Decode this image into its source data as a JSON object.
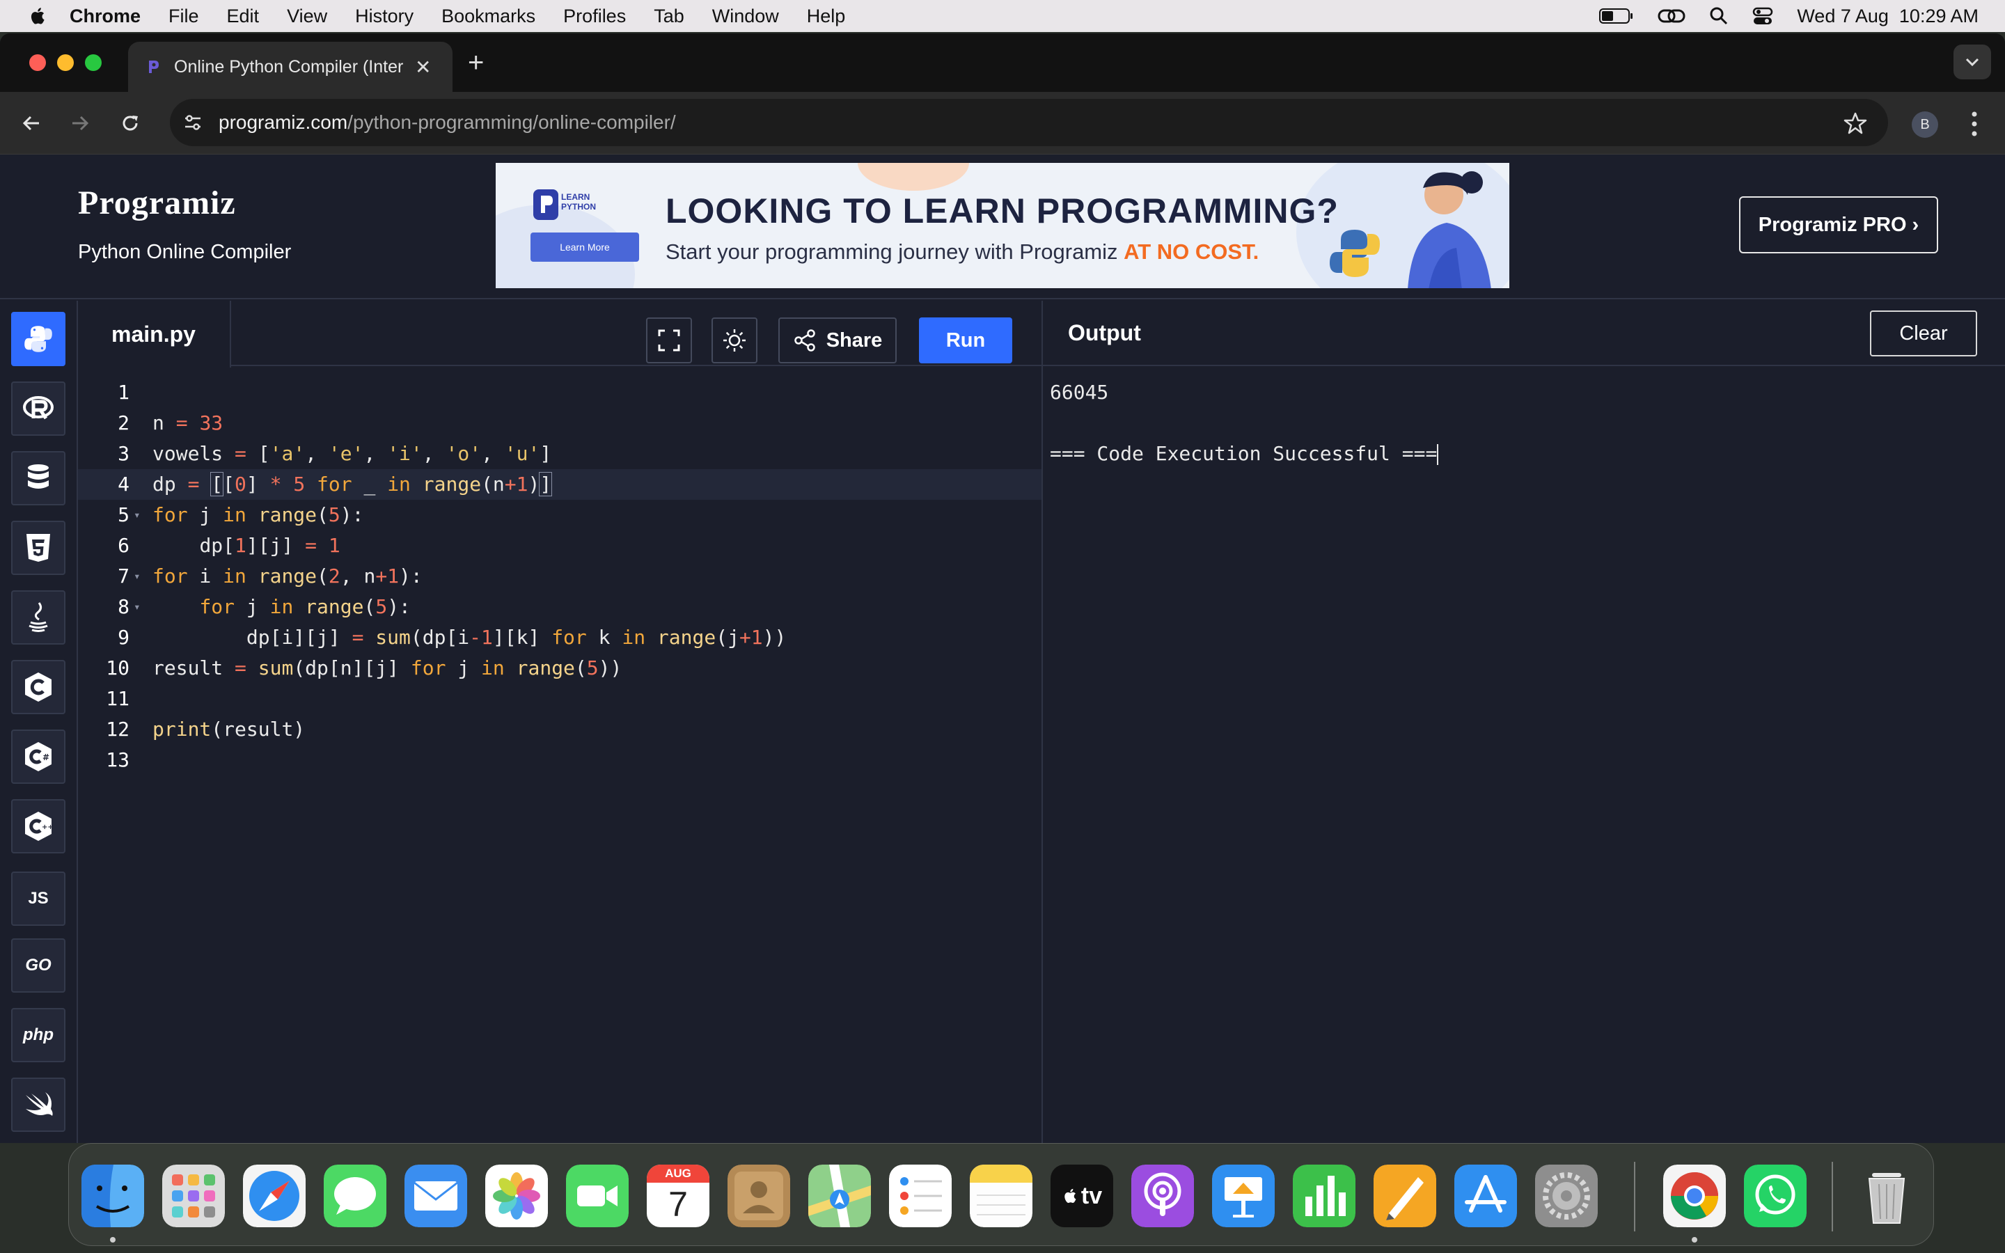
{
  "menubar": {
    "items": [
      "Chrome",
      "File",
      "Edit",
      "View",
      "History",
      "Bookmarks",
      "Profiles",
      "Tab",
      "Window",
      "Help"
    ],
    "datetime": "Wed 7 Aug  10:29 AM"
  },
  "browser": {
    "tab_title": "Online Python Compiler (Inter",
    "url_host": "programiz.com",
    "url_path": "/python-programming/online-compiler/",
    "profile_initial": "B"
  },
  "site": {
    "logo": "Programiz",
    "subtitle": "Python Online Compiler",
    "banner_title": "LOOKING TO LEARN PROGRAMMING?",
    "banner_sub": "Start your programming journey with Programiz ",
    "banner_em": "AT NO COST.",
    "banner_badge": "LEARN PYTHON",
    "banner_button": "Learn More",
    "pro_button": "Programiz PRO ›"
  },
  "sidebar": {
    "languages": [
      "python",
      "r",
      "sql",
      "html",
      "java",
      "c",
      "csharp",
      "cpp",
      "js",
      "go",
      "php",
      "swift"
    ],
    "labels": {
      "js": "JS",
      "go": "GO",
      "php": "php"
    }
  },
  "editor": {
    "filename": "main.py",
    "share_label": "Share",
    "run_label": "Run",
    "line_numbers": [
      "1",
      "2",
      "3",
      "4",
      "5",
      "6",
      "7",
      "8",
      "9",
      "10",
      "11",
      "12",
      "13"
    ]
  },
  "output": {
    "title": "Output",
    "clear_label": "Clear",
    "lines": [
      "66045",
      "",
      "=== Code Execution Successful ==="
    ]
  },
  "dock": {
    "apps": [
      "Finder",
      "Launchpad",
      "Safari",
      "Messages",
      "Mail",
      "Photos",
      "FaceTime",
      "Calendar",
      "Contacts",
      "Maps",
      "Reminders",
      "Notes",
      "Apple TV",
      "Podcasts",
      "Keynote",
      "Numbers",
      "Pages",
      "App Store",
      "System Settings",
      "Chrome",
      "WhatsApp",
      "Trash"
    ],
    "calendar_month": "AUG",
    "calendar_day": "7",
    "tv_label": "tv"
  },
  "colors": {
    "accent": "#2f6bff",
    "page_bg": "#1b1e2b",
    "keyword": "#f2a73b",
    "number": "#f2735c"
  }
}
